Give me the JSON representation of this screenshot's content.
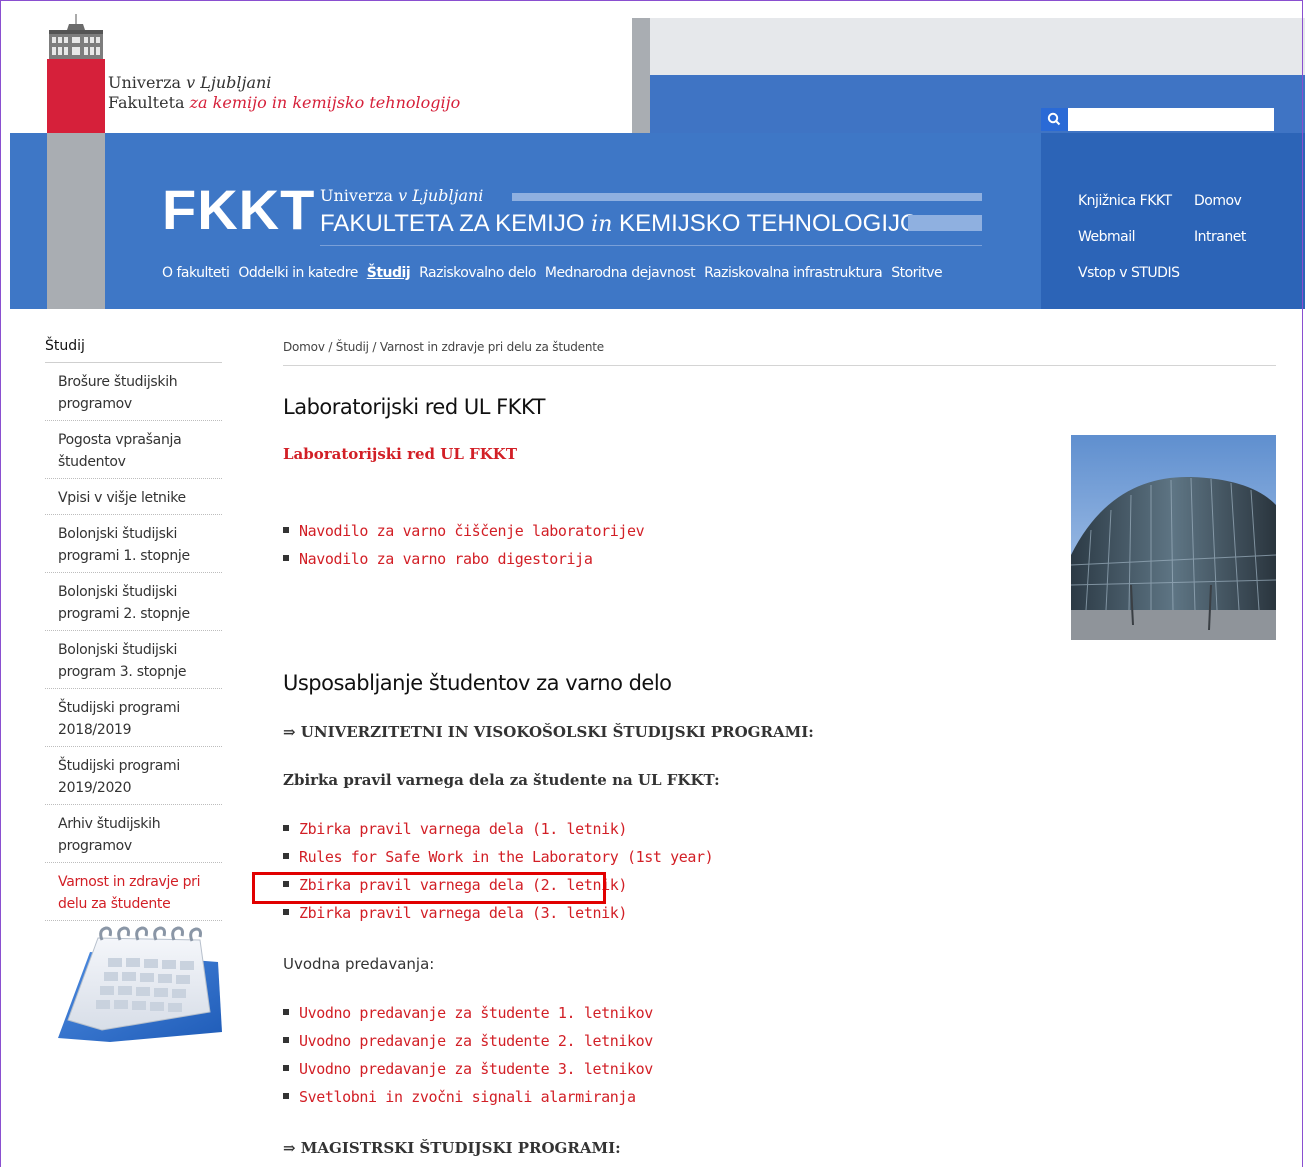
{
  "header": {
    "logo_line1_a": "Univerza ",
    "logo_line1_b": "v Ljubljani",
    "logo_line2_a": "Fakulteta ",
    "logo_line2_b": "za kemijo in kemijsko tehnologijo",
    "search": {
      "placeholder": "",
      "value": ""
    },
    "brand": {
      "abbr": "FKKT",
      "sub1_a": "Univerza ",
      "sub1_b": "v Ljubljani",
      "sub2_a": "FAKULTETA ZA KEMIJO ",
      "sub2_in": "in",
      "sub2_b": " KEMIJSKO TEHNOLOGIJO"
    },
    "nav": [
      {
        "label": "O fakulteti"
      },
      {
        "label": "Oddelki in katedre"
      },
      {
        "label": "Študij"
      },
      {
        "label": "Raziskovalno delo"
      },
      {
        "label": "Mednarodna dejavnost"
      },
      {
        "label": "Raziskovalna infrastruktura"
      },
      {
        "label": "Storitve"
      }
    ],
    "quick_links": {
      "library": "Knjižnica FKKT",
      "home": "Domov",
      "webmail": "Webmail",
      "intranet": "Intranet",
      "studis": "Vstop v STUDIS"
    }
  },
  "sidebar": {
    "title": "Študij",
    "items": [
      {
        "label": "Brošure študijskih programov"
      },
      {
        "label": "Pogosta vprašanja študentov"
      },
      {
        "label": "Vpisi v višje letnike"
      },
      {
        "label": "Bolonjski študijski programi 1. stopnje"
      },
      {
        "label": "Bolonjski študijski programi 2. stopnje"
      },
      {
        "label": "Bolonjski študijski program 3. stopnje"
      },
      {
        "label": "Študijski programi 2018/2019"
      },
      {
        "label": "Študijski programi 2019/2020"
      },
      {
        "label": "Arhiv študijskih programov"
      },
      {
        "label": "Varnost in zdravje pri delu za študente"
      }
    ]
  },
  "breadcrumb": {
    "home": "Domov",
    "sep": " / ",
    "study": "Študij",
    "current": "Varnost in zdravje pri delu za študente"
  },
  "main": {
    "h1": "Laboratorijski red UL FKKT",
    "red_link": "Laboratorijski red UL FKKT",
    "lab_links": [
      {
        "label": "Navodilo za varno čiščenje laboratorijev"
      },
      {
        "label": "Navodilo za varno rabo digestorija"
      }
    ],
    "h2": "Usposabljanje študentov za varno delo",
    "uni_heading": "⇒ UNIVERZITETNI IN VISOKOŠOLSKI ŠTUDIJSKI PROGRAMI:",
    "rules_heading": "Zbirka pravil varnega dela za študente na UL FKKT:",
    "rules_links": [
      {
        "label": "Zbirka pravil varnega dela (1. letnik)"
      },
      {
        "label": "Rules for Safe Work in the Laboratory (1st year)"
      },
      {
        "label": "Zbirka pravil varnega dela (2. letnik)"
      },
      {
        "label": "Zbirka pravil varnega dela (3. letnik)"
      }
    ],
    "intro_heading": "Uvodna predavanja:",
    "intro_links": [
      {
        "label": "Uvodno predavanje za študente 1. letnikov"
      },
      {
        "label": "Uvodno predavanje za študente 2. letnikov"
      },
      {
        "label": "Uvodno predavanje za študente 3. letnikov"
      },
      {
        "label": "Svetlobni in zvočni signali alarmiranja"
      }
    ],
    "masters_heading": "⇒ MAGISTRSKI ŠTUDIJSKI PROGRAMI:"
  },
  "colors": {
    "link_red": "#d21f26",
    "banner_blue": "#3e77c6",
    "logo_red": "#d6203a",
    "highlight": "#e10000"
  }
}
